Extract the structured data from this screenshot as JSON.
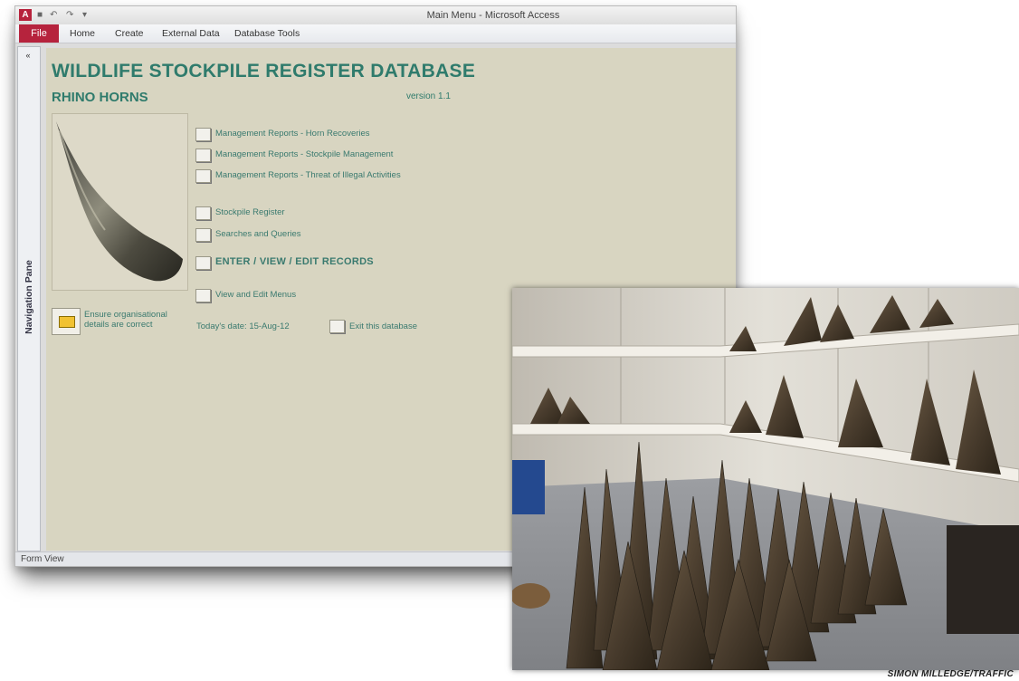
{
  "window": {
    "title": "Main Menu - Microsoft Access",
    "app_icon": "access-logo-icon"
  },
  "ribbon": {
    "file_label": "File",
    "tabs": [
      "Home",
      "Create",
      "External Data",
      "Database Tools"
    ]
  },
  "nav_pane": {
    "label": "Navigation Pane",
    "toggle": "«"
  },
  "form": {
    "title": "WILDLIFE STOCKPILE REGISTER DATABASE",
    "subtitle": "RHINO HORNS",
    "version": "version 1.1",
    "menu": [
      {
        "label": "Management Reports - Horn Recoveries"
      },
      {
        "label": "Management Reports - Stockpile Management"
      },
      {
        "label": "Management Reports - Threat of Illegal Activities"
      },
      {
        "label": "Stockpile Register"
      },
      {
        "label": "Searches and Queries"
      },
      {
        "label": "ENTER / VIEW / EDIT RECORDS"
      },
      {
        "label": "View and Edit Menus"
      }
    ],
    "org_label": "Ensure organisational details are correct",
    "date_label": "Today's date:   15-Aug-12",
    "exit_label": "Exit this database"
  },
  "status_bar": {
    "text": "Form View"
  },
  "photo": {
    "credit": "SIMON MILLEDGE/TRAFFIC"
  },
  "colors": {
    "form_bg": "#d8d5c1",
    "title_teal": "#2f7b6c",
    "file_tab": "#b6233d"
  }
}
